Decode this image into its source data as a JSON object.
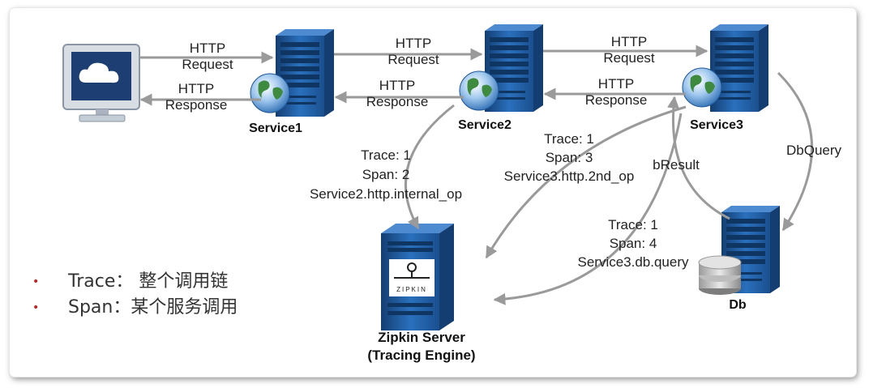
{
  "nodes": {
    "service1": "Service1",
    "service2": "Service2",
    "service3": "Service3",
    "db": "Db",
    "zipkin_title": "Zipkin Server",
    "zipkin_subtitle": "(Tracing Engine)",
    "zipkin_logo": "ZIPKIN"
  },
  "edges": {
    "client_s1_req": [
      "HTTP",
      "Request"
    ],
    "s1_client_resp": [
      "HTTP",
      "Response"
    ],
    "s1_s2_req": [
      "HTTP",
      "Request"
    ],
    "s2_s1_resp": [
      "HTTP",
      "Response"
    ],
    "s2_s3_req": [
      "HTTP",
      "Request"
    ],
    "s3_s2_resp": [
      "HTTP",
      "Response"
    ],
    "db_query": "DbQuery",
    "db_result": "bResult"
  },
  "traces": {
    "s2": [
      "Trace: 1",
      "Span: 2",
      "Service2.http.internal_op"
    ],
    "s3": [
      "Trace: 1",
      "Span: 3",
      "Service3.http.2nd_op"
    ],
    "db": [
      "Trace: 1",
      "Span: 4",
      "Service3.db.query"
    ]
  },
  "legend": [
    {
      "bullet": "•",
      "text": "Trace： 整个调用链"
    },
    {
      "bullet": "•",
      "text": "Span：某个服务调用"
    }
  ],
  "colors": {
    "server_blue": "#1f5fa8",
    "server_dark": "#123f75",
    "arrow_gray": "#9a9a9a",
    "bullet_red": "#bb2222"
  }
}
